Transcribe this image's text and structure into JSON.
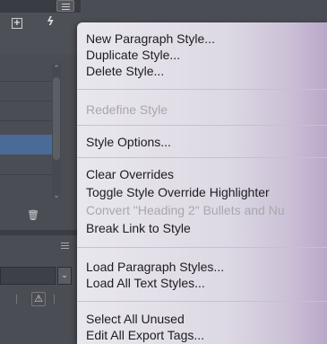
{
  "menu": {
    "groups": [
      {
        "items": [
          {
            "label": "New Paragraph Style...",
            "enabled": true
          },
          {
            "label": "Duplicate Style...",
            "enabled": true
          },
          {
            "label": "Delete Style...",
            "enabled": true
          }
        ]
      },
      {
        "items": [
          {
            "label": "Redefine Style",
            "enabled": false
          }
        ]
      },
      {
        "items": [
          {
            "label": "Style Options...",
            "enabled": true
          }
        ]
      },
      {
        "items": [
          {
            "label": "Clear Overrides",
            "enabled": true
          },
          {
            "label": "Toggle Style Override Highlighter",
            "enabled": true
          },
          {
            "label": "Convert \"Heading 2\" Bullets and Nu",
            "enabled": false
          },
          {
            "label": "Break Link to Style",
            "enabled": true
          }
        ]
      },
      {
        "items": [
          {
            "label": "Load Paragraph Styles...",
            "enabled": true
          },
          {
            "label": "Load All Text Styles...",
            "enabled": true
          }
        ]
      },
      {
        "items": [
          {
            "label": "Select All Unused",
            "enabled": true
          },
          {
            "label": "Edit All Export Tags...",
            "enabled": true
          }
        ]
      }
    ]
  },
  "panel": {
    "icons": [
      "panel-menu-icon",
      "new-style-group-icon",
      "clear-overrides-bolt-icon",
      "delete-trash-icon",
      "warning-icon",
      "dropdown-chevron-icon"
    ]
  },
  "colors": {
    "panel_bg": "#4b4d55",
    "selected_row": "#4a6a97",
    "menu_text": "#1c1c1e",
    "menu_disabled_text": "#a9a7ad"
  }
}
